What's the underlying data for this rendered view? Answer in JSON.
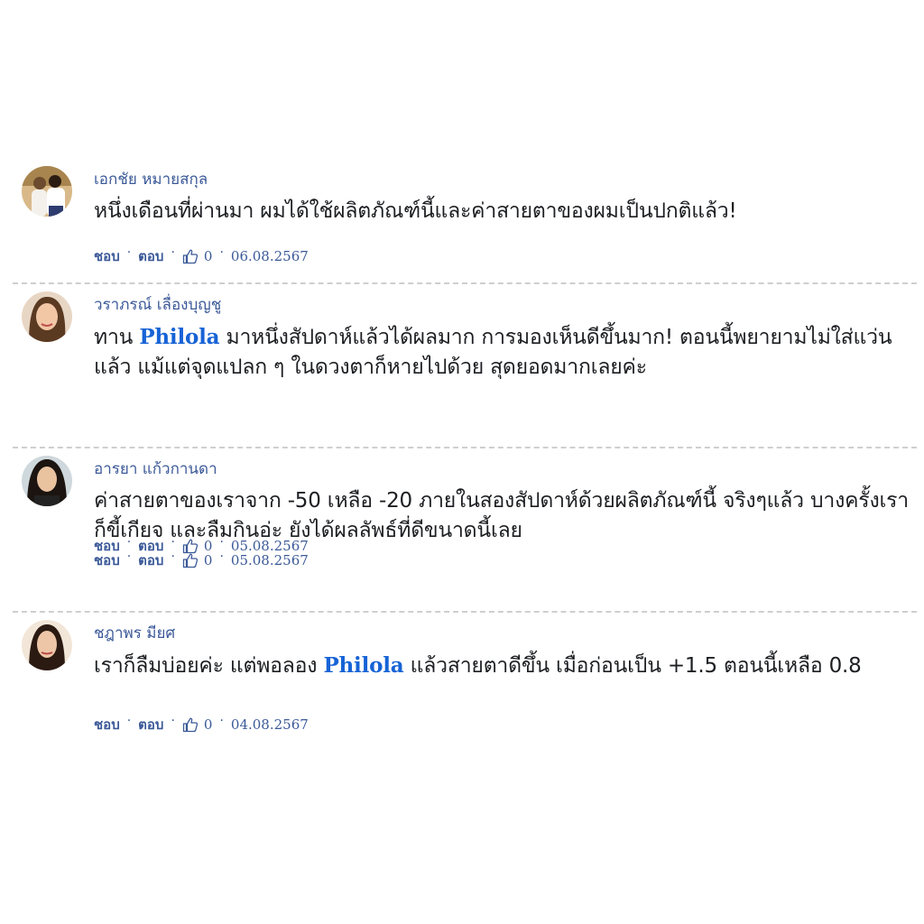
{
  "ui": {
    "like_label": "ชอบ",
    "reply_label": "ตอบ",
    "separator": "·"
  },
  "colors": {
    "author": "#3b5998",
    "brand": "#1763d6",
    "text": "#1c1e21",
    "divider": "#cfcfcf"
  },
  "comments": [
    {
      "author": "เอกชัย หมายสกุล",
      "text_before": "หนึ่งเดือนที่ผ่านมา ผมได้ใช้ผลิตภัณฑ์นี้และค่าสายตาของผมเป็นปกติแล้ว!",
      "brand": "",
      "text_after": "",
      "likes": "0",
      "date": "06.08.2567",
      "avatar_icon": "couple-photo-avatar"
    },
    {
      "author": "วราภรณ์ เลื่องบุญชู",
      "text_before": "ทาน ",
      "brand": "Philola",
      "text_after": " มาหนึ่งสัปดาห์แล้วได้ผลมาก การมองเห็นดีขึ้นมาก! ตอนนี้พยายามไม่ใส่แว่นแล้ว แม้แต่จุดแปลก ๆ ในดวงตาก็หายไปด้วย สุดยอดมากเลยค่ะ",
      "likes": "0",
      "date": "05.08.2567",
      "avatar_icon": "woman-photo-avatar"
    },
    {
      "author": "อารยา แก้วกานดา",
      "text_before": "ค่าสายตาของเราจาก -50 เหลือ -20 ภายในสองสัปดาห์ด้วยผลิตภัณฑ์นี้ จริงๆแล้ว บางครั้งเราก็ขี้เกียจ และลืมกินอ่ะ ยังได้ผลลัพธ์ที่ดีขนาดนี้เลย",
      "brand": "",
      "text_after": "",
      "likes": "0",
      "date": "05.08.2567",
      "avatar_icon": "woman-photo-avatar"
    },
    {
      "author": "ชฎาพร มียศ",
      "text_before": "เราก็ลืมบ่อยค่ะ แต่พอลอง ",
      "brand": "Philola",
      "text_after": " แล้วสายตาดีขึ้น เมื่อก่อนเป็น +1.5 ตอนนี้เหลือ 0.8",
      "likes": "0",
      "date": "04.08.2567",
      "avatar_icon": "woman-photo-avatar"
    }
  ]
}
